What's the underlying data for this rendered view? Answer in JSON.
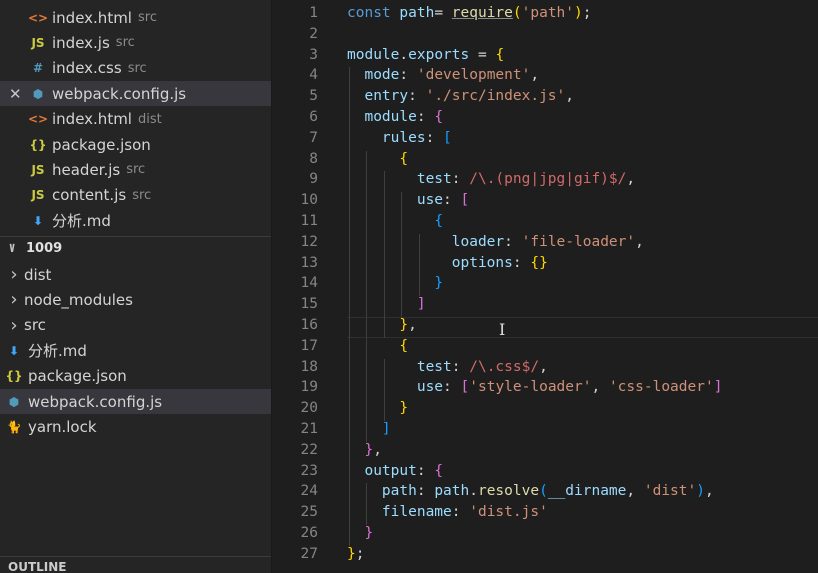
{
  "sidebar": {
    "open_editors": [
      {
        "icon": "<>",
        "icon_color": "#e37933",
        "name": "index.html",
        "desc": "src",
        "selected": false,
        "close": false
      },
      {
        "icon": "JS",
        "icon_color": "#cbcb41",
        "name": "index.js",
        "desc": "src",
        "selected": false,
        "close": false
      },
      {
        "icon": "#",
        "icon_color": "#519aba",
        "name": "index.css",
        "desc": "src",
        "selected": false,
        "close": false
      },
      {
        "icon": "⬢",
        "icon_color": "#519aba",
        "name": "webpack.config.js",
        "desc": "",
        "selected": true,
        "close": true
      },
      {
        "icon": "<>",
        "icon_color": "#e37933",
        "name": "index.html",
        "desc": "dist",
        "selected": false,
        "close": false
      },
      {
        "icon": "{}",
        "icon_color": "#cbcb41",
        "name": "package.json",
        "desc": "",
        "selected": false,
        "close": false
      },
      {
        "icon": "JS",
        "icon_color": "#cbcb41",
        "name": "header.js",
        "desc": "src",
        "selected": false,
        "close": false
      },
      {
        "icon": "JS",
        "icon_color": "#cbcb41",
        "name": "content.js",
        "desc": "src",
        "selected": false,
        "close": false
      },
      {
        "icon": "⬇",
        "icon_color": "#42a5f5",
        "name": "分析.md",
        "desc": "",
        "selected": false,
        "close": false
      }
    ],
    "folder_name": "1009",
    "tree": [
      {
        "chevron": ">",
        "icon": "",
        "icon_color": "",
        "name": "dist",
        "selected": false
      },
      {
        "chevron": ">",
        "icon": "",
        "icon_color": "",
        "name": "node_modules",
        "selected": false
      },
      {
        "chevron": ">",
        "icon": "",
        "icon_color": "",
        "name": "src",
        "selected": false
      },
      {
        "chevron": "",
        "icon": "⬇",
        "icon_color": "#42a5f5",
        "name": "分析.md",
        "selected": false
      },
      {
        "chevron": "",
        "icon": "{}",
        "icon_color": "#cbcb41",
        "name": "package.json",
        "selected": false
      },
      {
        "chevron": "",
        "icon": "⬢",
        "icon_color": "#519aba",
        "name": "webpack.config.js",
        "selected": true
      },
      {
        "chevron": "",
        "icon": "🐈",
        "icon_color": "#2188b6",
        "name": "yarn.lock",
        "selected": false
      }
    ],
    "outline_label": "OUTLINE"
  },
  "editor": {
    "lines": [
      [
        [
          "kw",
          "const "
        ],
        [
          "vr",
          "path"
        ],
        [
          "",
          "= "
        ],
        [
          "fn ul",
          "require"
        ],
        [
          "b1",
          "("
        ],
        [
          "st",
          "'path'"
        ],
        [
          "b1",
          ")"
        ],
        [
          "",
          ";"
        ]
      ],
      [],
      [
        [
          "vr",
          "module"
        ],
        [
          "",
          ""
        ],
        [
          "vr",
          "exports"
        ],
        [
          "",
          " = "
        ],
        [
          "b1",
          "{"
        ]
      ],
      [
        [
          "",
          " "
        ],
        [
          "vr",
          "mode"
        ],
        [
          "",
          ": "
        ],
        [
          "st",
          "'development'"
        ],
        [
          "",
          ","
        ]
      ],
      [
        [
          "",
          " "
        ],
        [
          "vr",
          "entry"
        ],
        [
          "",
          ": "
        ],
        [
          "st",
          "'./src/index.js'"
        ],
        [
          "",
          ","
        ]
      ],
      [
        [
          "",
          " "
        ],
        [
          "vr",
          "module"
        ],
        [
          "",
          ": "
        ],
        [
          "b2",
          "{"
        ]
      ],
      [
        [
          "",
          "    "
        ],
        [
          "vr",
          "rules"
        ],
        [
          "",
          ": "
        ],
        [
          "b3",
          "["
        ]
      ],
      [
        [
          "",
          "      "
        ],
        [
          "b1",
          "{"
        ]
      ],
      [
        [
          "",
          "        "
        ],
        [
          "vr",
          "test"
        ],
        [
          "",
          ": "
        ],
        [
          "re",
          "/\\.(png|jpg|gif)$/"
        ],
        [
          "",
          ","
        ]
      ],
      [
        [
          "",
          "        "
        ],
        [
          "vr",
          "use"
        ],
        [
          "",
          ": "
        ],
        [
          "b2",
          "["
        ]
      ],
      [
        [
          "",
          "          "
        ],
        [
          "b3",
          "{"
        ]
      ],
      [
        [
          "",
          "            "
        ],
        [
          "vr",
          "loader"
        ],
        [
          "",
          ": "
        ],
        [
          "st",
          "'file-loader'"
        ],
        [
          "",
          ","
        ]
      ],
      [
        [
          "",
          "            "
        ],
        [
          "vr",
          "options"
        ],
        [
          "",
          ": "
        ],
        [
          "b1",
          "{}"
        ]
      ],
      [
        [
          "",
          "          "
        ],
        [
          "b3",
          "}"
        ]
      ],
      [
        [
          "",
          "        "
        ],
        [
          "b2",
          "]"
        ]
      ],
      [
        [
          "",
          "      "
        ],
        [
          "b1",
          "}"
        ],
        [
          "",
          ","
        ]
      ],
      [
        [
          "",
          "      "
        ],
        [
          "b1",
          "{"
        ]
      ],
      [
        [
          "",
          "        "
        ],
        [
          "vr",
          "test"
        ],
        [
          "",
          ": "
        ],
        [
          "re",
          "/\\.css$/"
        ],
        [
          "",
          ","
        ]
      ],
      [
        [
          "",
          "        "
        ],
        [
          "vr",
          "use"
        ],
        [
          "",
          ": "
        ],
        [
          "b2",
          "["
        ],
        [
          "st",
          "'style-loader'"
        ],
        [
          "",
          ", "
        ],
        [
          "st",
          "'css-loader'"
        ],
        [
          "b2",
          "]"
        ]
      ],
      [
        [
          "",
          "      "
        ],
        [
          "b1",
          "}"
        ]
      ],
      [
        [
          "",
          "    "
        ],
        [
          "b3",
          "]"
        ]
      ],
      [
        [
          "",
          " "
        ],
        [
          "b2",
          "}"
        ],
        [
          "",
          ","
        ]
      ],
      [
        [
          "",
          " "
        ],
        [
          "vr",
          "output"
        ],
        [
          "",
          ": "
        ],
        [
          "b2",
          "{"
        ]
      ],
      [
        [
          "",
          "    "
        ],
        [
          "vr",
          "path"
        ],
        [
          "",
          ": "
        ],
        [
          "vr",
          "path"
        ],
        [
          "",
          "."
        ],
        [
          "fn",
          "resolve"
        ],
        [
          "b3",
          "("
        ],
        [
          "vr",
          "__dirname"
        ],
        [
          "",
          ", "
        ],
        [
          "st",
          "'dist'"
        ],
        [
          "b3",
          ")"
        ],
        [
          "",
          ","
        ]
      ],
      [
        [
          "",
          "    "
        ],
        [
          "vr",
          "filename"
        ],
        [
          "",
          ": "
        ],
        [
          "st",
          "'dist.js'"
        ]
      ],
      [
        [
          "",
          " "
        ],
        [
          "b2",
          "}"
        ]
      ],
      [
        [
          "b1",
          "}"
        ],
        [
          "",
          ";"
        ]
      ]
    ]
  }
}
